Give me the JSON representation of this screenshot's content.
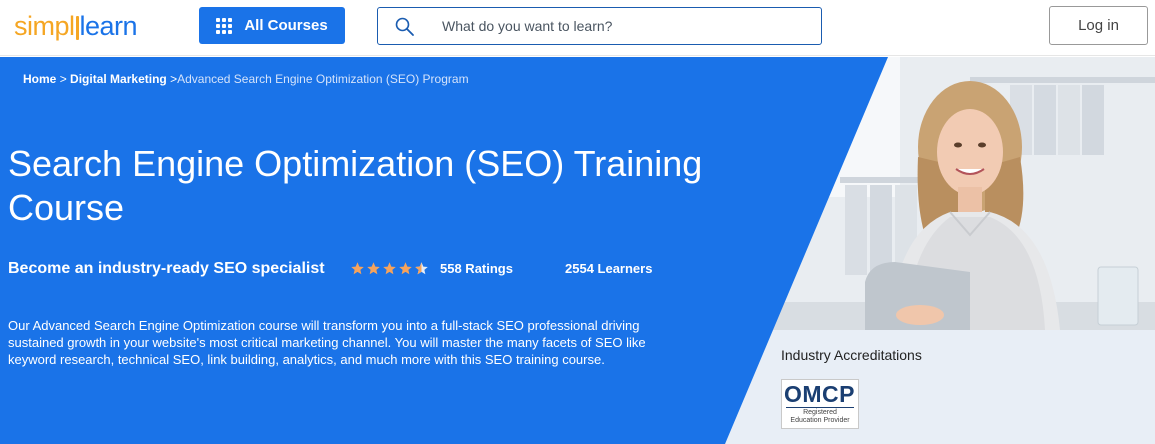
{
  "header": {
    "logo": {
      "part1": "simpl",
      "part2": "learn"
    },
    "all_courses_label": "All Courses",
    "search_placeholder": "What do you want to learn?",
    "login_label": "Log in"
  },
  "breadcrumb": {
    "items": [
      "Home",
      "Digital Marketing"
    ],
    "separator": ">",
    "current": "Advanced Search Engine Optimization (SEO) Program"
  },
  "hero": {
    "title": "Search Engine Optimization (SEO) Training Course",
    "subtitle": "Become an industry-ready SEO specialist",
    "rating": {
      "stars": 4.5,
      "count_label": "558 Ratings"
    },
    "learners_label": "2554 Learners",
    "description": "Our Advanced Search Engine Optimization course will transform you into a full-stack SEO professional driving sustained growth in your website's most critical marketing channel. You will master the many facets of SEO like keyword research, technical SEO, link building, analytics, and much more with this SEO training course."
  },
  "accreditations": {
    "title": "Industry Accreditations",
    "badge": {
      "name": "OMCP",
      "line1": "Registered",
      "line2": "Education Provider"
    }
  },
  "colors": {
    "brand_blue": "#1a73e8",
    "logo_orange": "#f5a623",
    "hero_blue": "#1a73e8",
    "star_orange": "#f5a35c"
  },
  "icons": {
    "grid": "grid-icon",
    "search": "search-icon",
    "star": "star-icon",
    "half_star": "star-half-icon"
  }
}
